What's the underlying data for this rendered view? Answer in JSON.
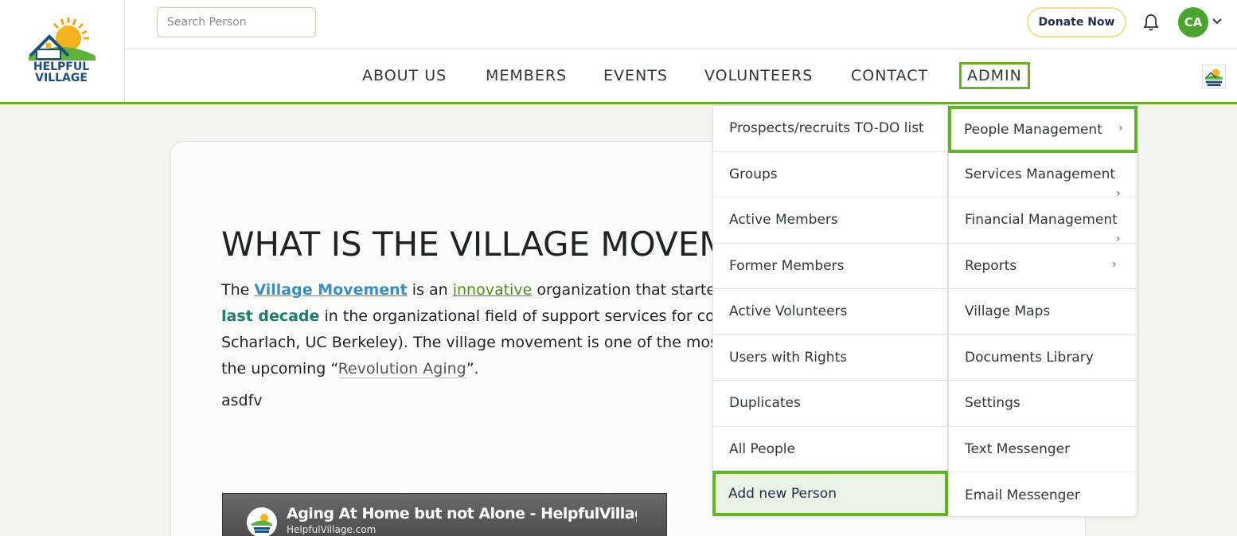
{
  "brand": {
    "logo_line1": "HELPFUL",
    "logo_line2": "VILLAGE"
  },
  "header": {
    "search_placeholder": "Search Person",
    "donate_label": "Donate Now",
    "avatar_initials": "CA"
  },
  "nav": {
    "items": [
      {
        "label": "ABOUT US"
      },
      {
        "label": "MEMBERS"
      },
      {
        "label": "EVENTS"
      },
      {
        "label": "VOLUNTEERS"
      },
      {
        "label": "CONTACT"
      },
      {
        "label": "ADMIN"
      }
    ]
  },
  "content": {
    "heading": "WHAT IS THE VILLAGE MOVEMENT?",
    "line1_pre": "The ",
    "link_village": "Village Movement",
    "line1_mid": " is an ",
    "link_innovative": "innovative",
    "line1_post": " organization that started in the",
    "line2_bold": "last decade",
    "line2_post": " in the organizational field of support services for community",
    "line3": "Scharlach, UC Berkeley). The village movement is one of the most visible",
    "line4_pre": "the upcoming “",
    "link_revolution": "Revolution Aging",
    "line4_post": "”.",
    "extra": "asdfv"
  },
  "video": {
    "title": "Aging At Home but not Alone - HelpfulVillage.com",
    "channel": "HelpfulVillage.com"
  },
  "admin_menu": {
    "left": [
      {
        "label": "Prospects/recruits TO-DO list"
      },
      {
        "label": "Groups"
      },
      {
        "label": "Active Members"
      },
      {
        "label": "Former Members"
      },
      {
        "label": "Active Volunteers"
      },
      {
        "label": "Users with Rights"
      },
      {
        "label": "Duplicates"
      },
      {
        "label": "All People"
      },
      {
        "label": "Add new Person"
      }
    ],
    "right": [
      {
        "label": "People Management",
        "submenu": true
      },
      {
        "label": "Services Management",
        "submenu": true
      },
      {
        "label": "Financial Management",
        "submenu": true
      },
      {
        "label": "Reports",
        "submenu": true
      },
      {
        "label": "Village Maps"
      },
      {
        "label": "Documents Library"
      },
      {
        "label": "Settings"
      },
      {
        "label": "Text Messenger"
      },
      {
        "label": "Email Messenger"
      }
    ],
    "chevron": "›"
  },
  "colors": {
    "accent_green": "#62b32a",
    "nav_text": "#2e3a2e",
    "link_blue": "#3b8dc4"
  }
}
